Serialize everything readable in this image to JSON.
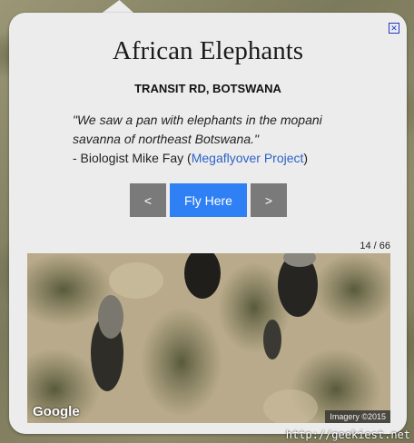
{
  "popup": {
    "title": "African Elephants",
    "location": "TRANSIT RD, BOTSWANA",
    "quote": "\"We saw a pan with elephants in the mopani savanna of northeast Botswana.\"",
    "attribution_prefix": "- Biologist Mike Fay (",
    "attribution_link": "Megaflyover Project",
    "attribution_suffix": ")",
    "close_icon": "close-icon"
  },
  "nav": {
    "prev_label": "<",
    "fly_label": "Fly Here",
    "next_label": ">"
  },
  "counter": "14 / 66",
  "photo": {
    "google_logo": "Google",
    "imagery_credit": "Imagery ©2015"
  },
  "watermark": "http://geekiest.net",
  "colors": {
    "accent": "#2f80f4",
    "nav_button": "#7a7a7a",
    "link": "#2d62c8"
  }
}
